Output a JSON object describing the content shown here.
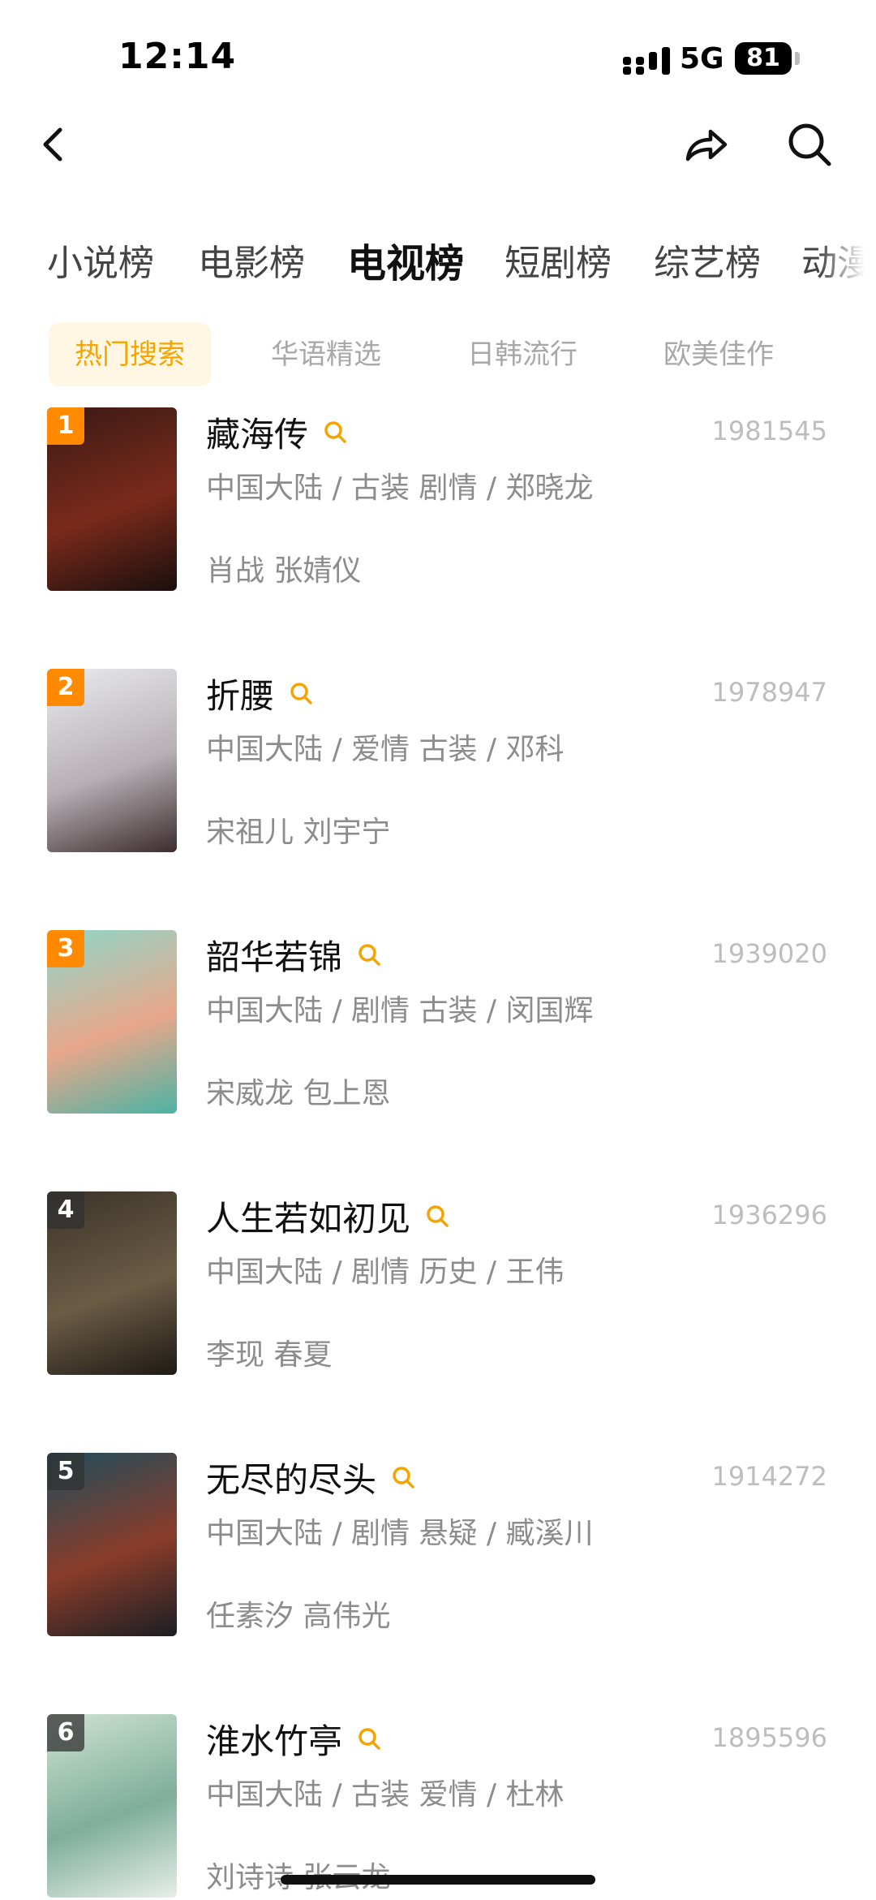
{
  "status_bar": {
    "time": "12:14",
    "network": "5G",
    "battery": "81"
  },
  "category_tabs": [
    {
      "label": "小说榜",
      "active": false
    },
    {
      "label": "电影榜",
      "active": false
    },
    {
      "label": "电视榜",
      "active": true
    },
    {
      "label": "短剧榜",
      "active": false
    },
    {
      "label": "综艺榜",
      "active": false
    },
    {
      "label": "动漫",
      "active": false
    }
  ],
  "sub_tabs": [
    {
      "label": "热门搜索",
      "active": true
    },
    {
      "label": "华语精选",
      "active": false
    },
    {
      "label": "日韩流行",
      "active": false
    },
    {
      "label": "欧美佳作",
      "active": false
    }
  ],
  "colors": {
    "accent": "#ff8a00",
    "sub_tab_active_text": "#f5a400",
    "sub_tab_active_bg": "#fff7e3"
  },
  "icons": {
    "back": "chevron-left-icon",
    "share": "share-arrow-icon",
    "search": "search-icon",
    "title_search": "search-icon"
  },
  "list": [
    {
      "rank": "1",
      "title": "藏海传",
      "score": "1981545",
      "meta": "中国大陆 / 古装 剧情 / 郑晓龙",
      "cast": "肖战 张婧仪",
      "poster_colors": [
        "#3a1a14",
        "#7a2a1c",
        "#1a0f0c"
      ]
    },
    {
      "rank": "2",
      "title": "折腰",
      "score": "1978947",
      "meta": "中国大陆 / 爱情 古装 / 邓科",
      "cast": "宋祖儿 刘宇宁",
      "poster_colors": [
        "#e9ebee",
        "#b7b0b5",
        "#3c2c2e"
      ]
    },
    {
      "rank": "3",
      "title": "韶华若锦",
      "score": "1939020",
      "meta": "中国大陆 / 剧情 古装 / 闵国辉",
      "cast": "宋威龙 包上恩",
      "poster_colors": [
        "#8fd7c9",
        "#e8a78b",
        "#4bb3a4"
      ]
    },
    {
      "rank": "4",
      "title": "人生若如初见",
      "score": "1936296",
      "meta": "中国大陆 / 剧情 历史 / 王伟",
      "cast": "李现 春夏",
      "poster_colors": [
        "#3b3328",
        "#6b5c45",
        "#1f1a14"
      ]
    },
    {
      "rank": "5",
      "title": "无尽的尽头",
      "score": "1914272",
      "meta": "中国大陆 / 剧情 悬疑 / 臧溪川",
      "cast": "任素汐 高伟光",
      "poster_colors": [
        "#1f4d5c",
        "#8a3c2a",
        "#1a1f24"
      ]
    },
    {
      "rank": "6",
      "title": "淮水竹亭",
      "score": "1895596",
      "meta": "中国大陆 / 古装 爱情 / 杜林",
      "cast": "刘诗诗 张云龙",
      "poster_colors": [
        "#cfe2d3",
        "#7fae9a",
        "#e7efe8"
      ]
    }
  ]
}
